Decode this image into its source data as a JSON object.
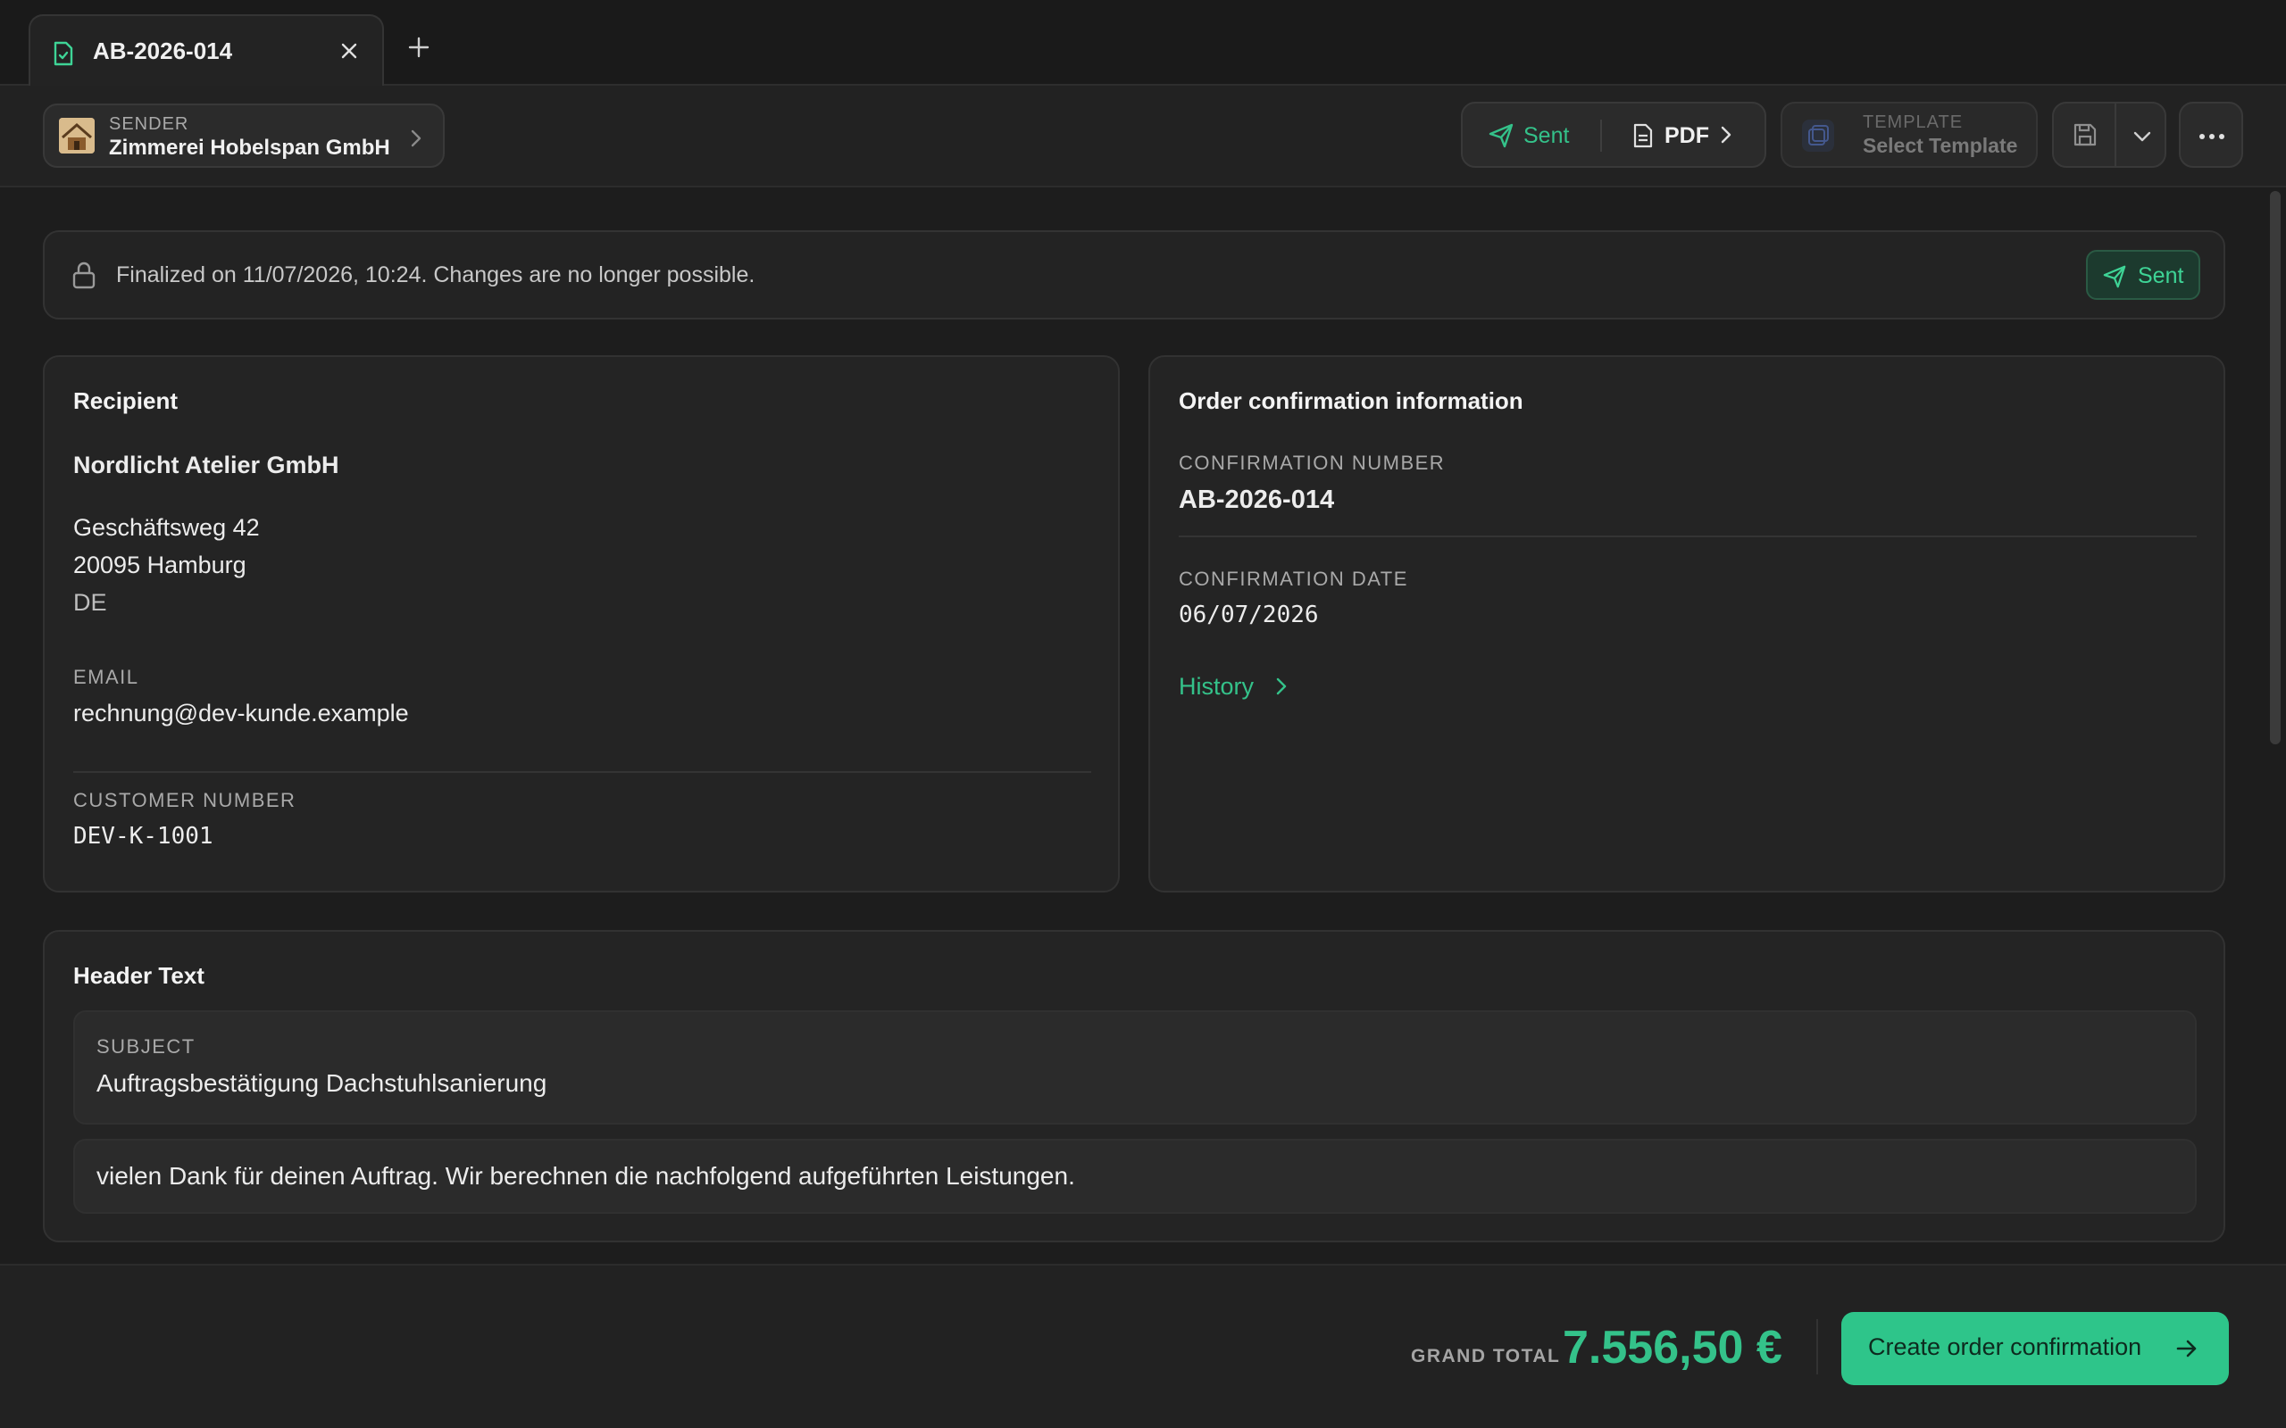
{
  "tab": {
    "title": "AB-2026-014"
  },
  "toolbar": {
    "sender_label": "SENDER",
    "sender_name": "Zimmerei Hobelspan GmbH",
    "sent_label": "Sent",
    "pdf_label": "PDF",
    "template_label": "TEMPLATE",
    "template_value": "Select Template"
  },
  "banner": {
    "text": "Finalized on 11/07/2026, 10:24. Changes are no longer possible.",
    "badge": "Sent"
  },
  "recipient": {
    "heading": "Recipient",
    "company": "Nordlicht Atelier GmbH",
    "street": "Geschäftsweg 42",
    "city": "20095 Hamburg",
    "country": "DE",
    "email_label": "EMAIL",
    "email": "rechnung@dev-kunde.example",
    "customer_number_label": "CUSTOMER NUMBER",
    "customer_number": "DEV-K-1001"
  },
  "order_info": {
    "heading": "Order confirmation information",
    "number_label": "CONFIRMATION NUMBER",
    "number": "AB-2026-014",
    "date_label": "CONFIRMATION DATE",
    "date": "06/07/2026",
    "history_link": "History"
  },
  "header_text": {
    "heading": "Header Text",
    "subject_label": "SUBJECT",
    "subject": "Auftragsbestätigung Dachstuhlsanierung",
    "body": "vielen Dank für deinen Auftrag. Wir berechnen die nachfolgend aufgeführten Leistungen."
  },
  "footer": {
    "grand_total_label": "GRAND TOTAL",
    "grand_total_value": "7.556,50 €",
    "create_button": "Create order confirmation"
  },
  "colors": {
    "accent": "#2ec58a",
    "background": "#1d1d1d",
    "card": "#242424"
  }
}
